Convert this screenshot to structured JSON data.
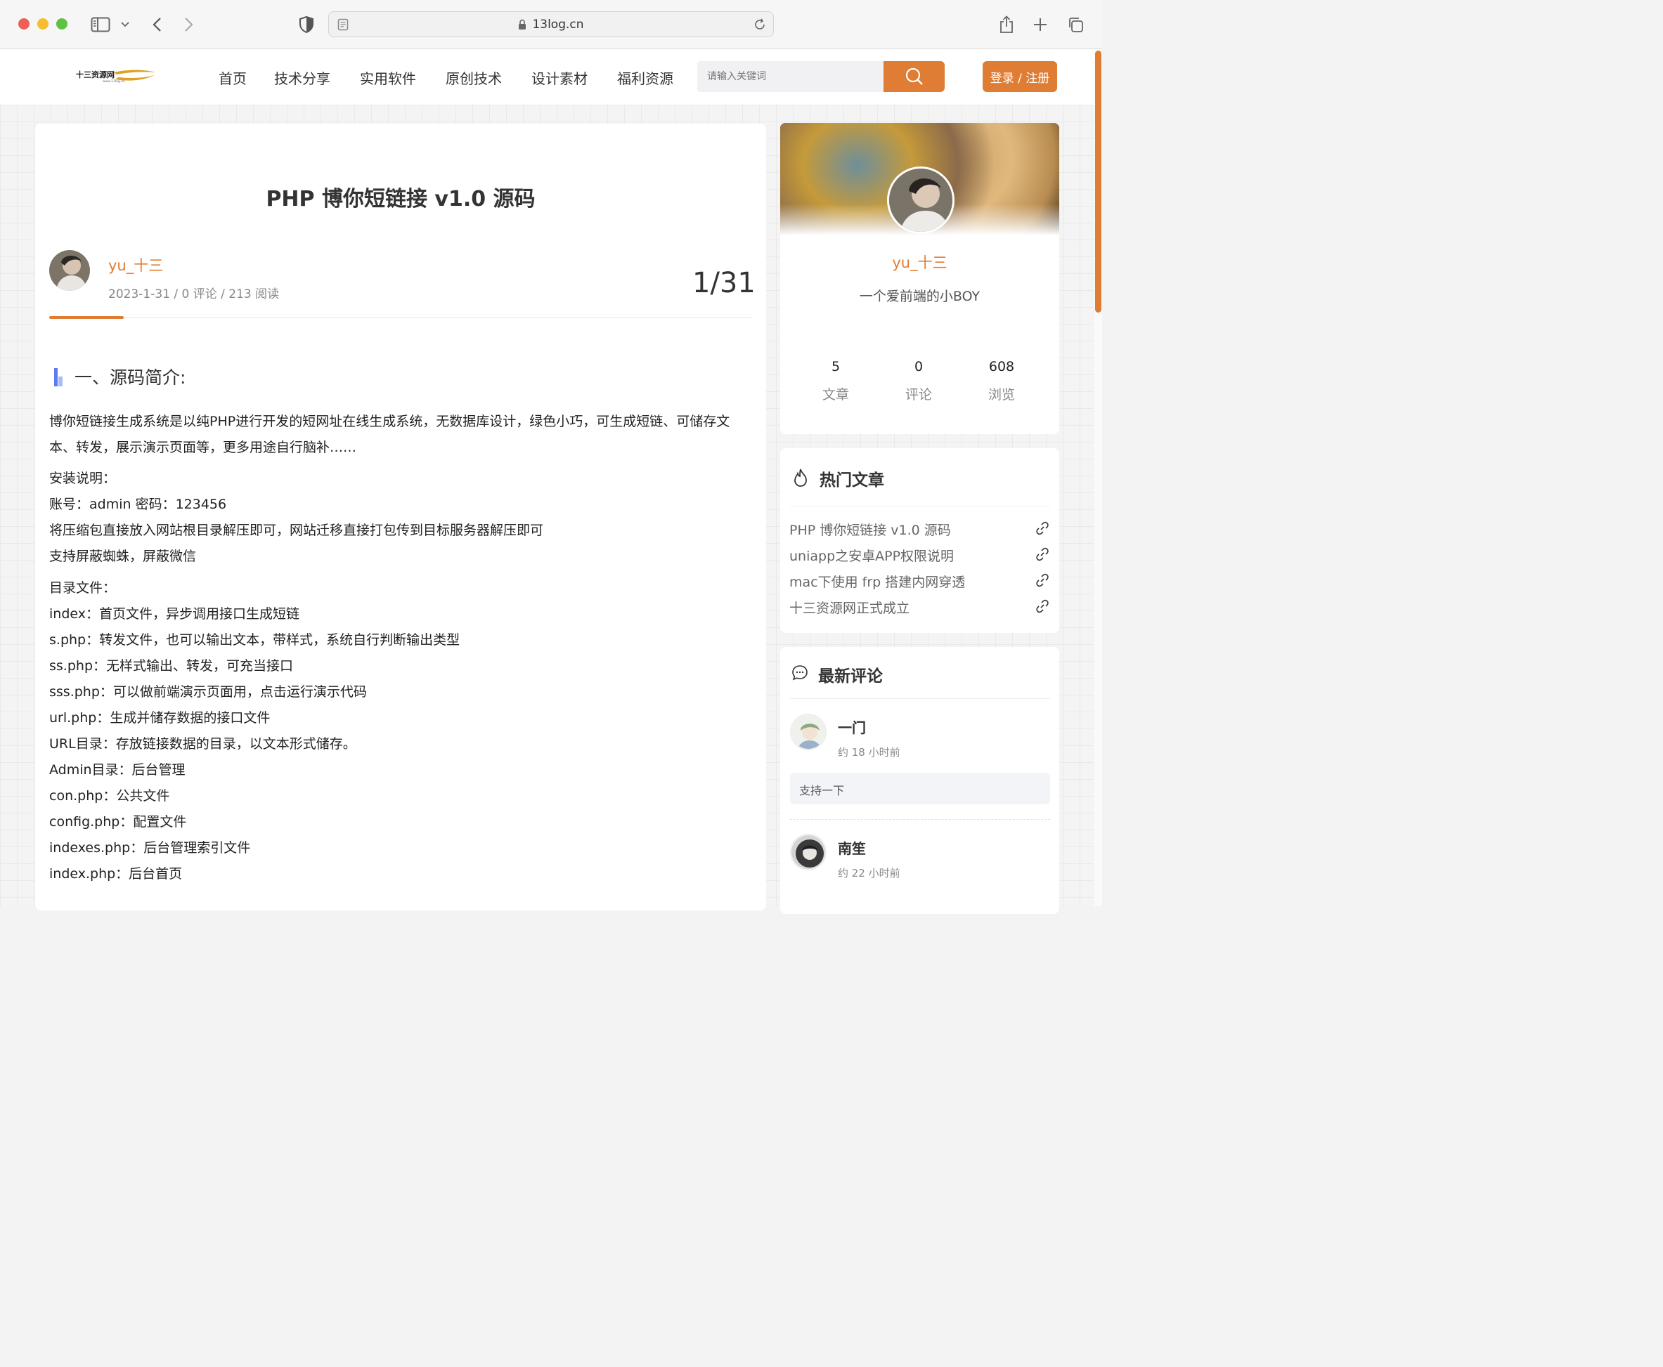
{
  "browser": {
    "url": "13log.cn"
  },
  "site": {
    "logo_text": "十三资源网",
    "logo_subtext": "www.13log.cn",
    "nav": [
      "首页",
      "技术分享",
      "实用软件",
      "原创技术",
      "设计素材",
      "福利资源"
    ],
    "search_placeholder": "请输入关键词",
    "login_label": "登录 / 注册",
    "accent_color": "#e07d34"
  },
  "article": {
    "title": "PHP 博你短链接 v1.0 源码",
    "author": "yu_十三",
    "meta": "2023-1-31 / 0 评论 / 213 阅读",
    "page_count": "1/31",
    "section_heading": "一、源码简介:",
    "intro": "博你短链接生成系统是以纯PHP进行开发的短网址在线生成系统，无数据库设计，绿色小巧，可生成短链、可储存文本、转发，展示演示页面等，更多用途自行脑补……",
    "lines": [
      "安装说明：",
      "账号：admin 密码：123456",
      "将压缩包直接放入网站根目录解压即可，网站迁移直接打包传到目标服务器解压即可",
      "支持屏蔽蜘蛛，屏蔽微信",
      "目录文件：",
      "index：首页文件，异步调用接口生成短链",
      "s.php：转发文件，也可以输出文本，带样式，系统自行判断输出类型",
      "ss.php：无样式输出、转发，可充当接口",
      "sss.php：可以做前端演示页面用，点击运行演示代码",
      "url.php：生成并储存数据的接口文件",
      "URL目录：存放链接数据的目录，以文本形式储存。",
      "Admin目录：后台管理",
      "con.php：公共文件",
      "config.php：配置文件",
      "indexes.php：后台管理索引文件",
      "index.php：后台首页"
    ]
  },
  "profile": {
    "name": "yu_十三",
    "description": "一个爱前端的小BOY",
    "stats": [
      {
        "value": "5",
        "label": "文章"
      },
      {
        "value": "0",
        "label": "评论"
      },
      {
        "value": "608",
        "label": "浏览"
      }
    ]
  },
  "hot_articles": {
    "heading": "热门文章",
    "items": [
      "PHP 博你短链接 v1.0 源码",
      "uniapp之安卓APP权限说明",
      "mac下使用 frp 搭建内网穿透",
      "十三资源网正式成立"
    ]
  },
  "latest_comments": {
    "heading": "最新评论",
    "items": [
      {
        "name": "一门",
        "time": "约 18 小时前",
        "text": "支持一下"
      },
      {
        "name": "南笙",
        "time": "约 22 小时前",
        "text": ""
      }
    ]
  }
}
